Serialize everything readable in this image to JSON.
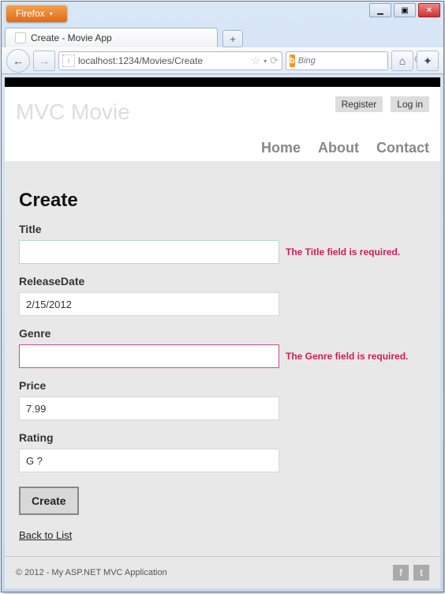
{
  "browser": {
    "app_button": "Firefox",
    "tab_title": "Create - Movie App",
    "url": "localhost:1234/Movies/Create",
    "search_placeholder": "Bing",
    "reload_glyph": "⟳",
    "back_glyph": "←",
    "fwd_glyph": "→",
    "star_glyph": "☆",
    "home_glyph": "⌂",
    "bookmark_glyph": "✦",
    "plus_glyph": "+",
    "search_go_glyph": "🔍",
    "win_min": "▁",
    "win_max": "▣",
    "win_close": "✕",
    "drop_glyph": "▾"
  },
  "header": {
    "register": "Register",
    "login": "Log in",
    "logo": "MVC Movie",
    "nav": {
      "home": "Home",
      "about": "About",
      "contact": "Contact"
    }
  },
  "form": {
    "heading": "Create",
    "title_label": "Title",
    "title_value": "",
    "title_error": "The Title field is required.",
    "release_label": "ReleaseDate",
    "release_value": "2/15/2012",
    "genre_label": "Genre",
    "genre_value": "",
    "genre_error": "The Genre field is required.",
    "price_label": "Price",
    "price_value": "7.99",
    "rating_label": "Rating",
    "rating_value": "G ?",
    "submit": "Create",
    "back": "Back to List"
  },
  "footer": {
    "copyright": "© 2012 - My ASP.NET MVC Application",
    "fb": "f",
    "tw": "t"
  }
}
